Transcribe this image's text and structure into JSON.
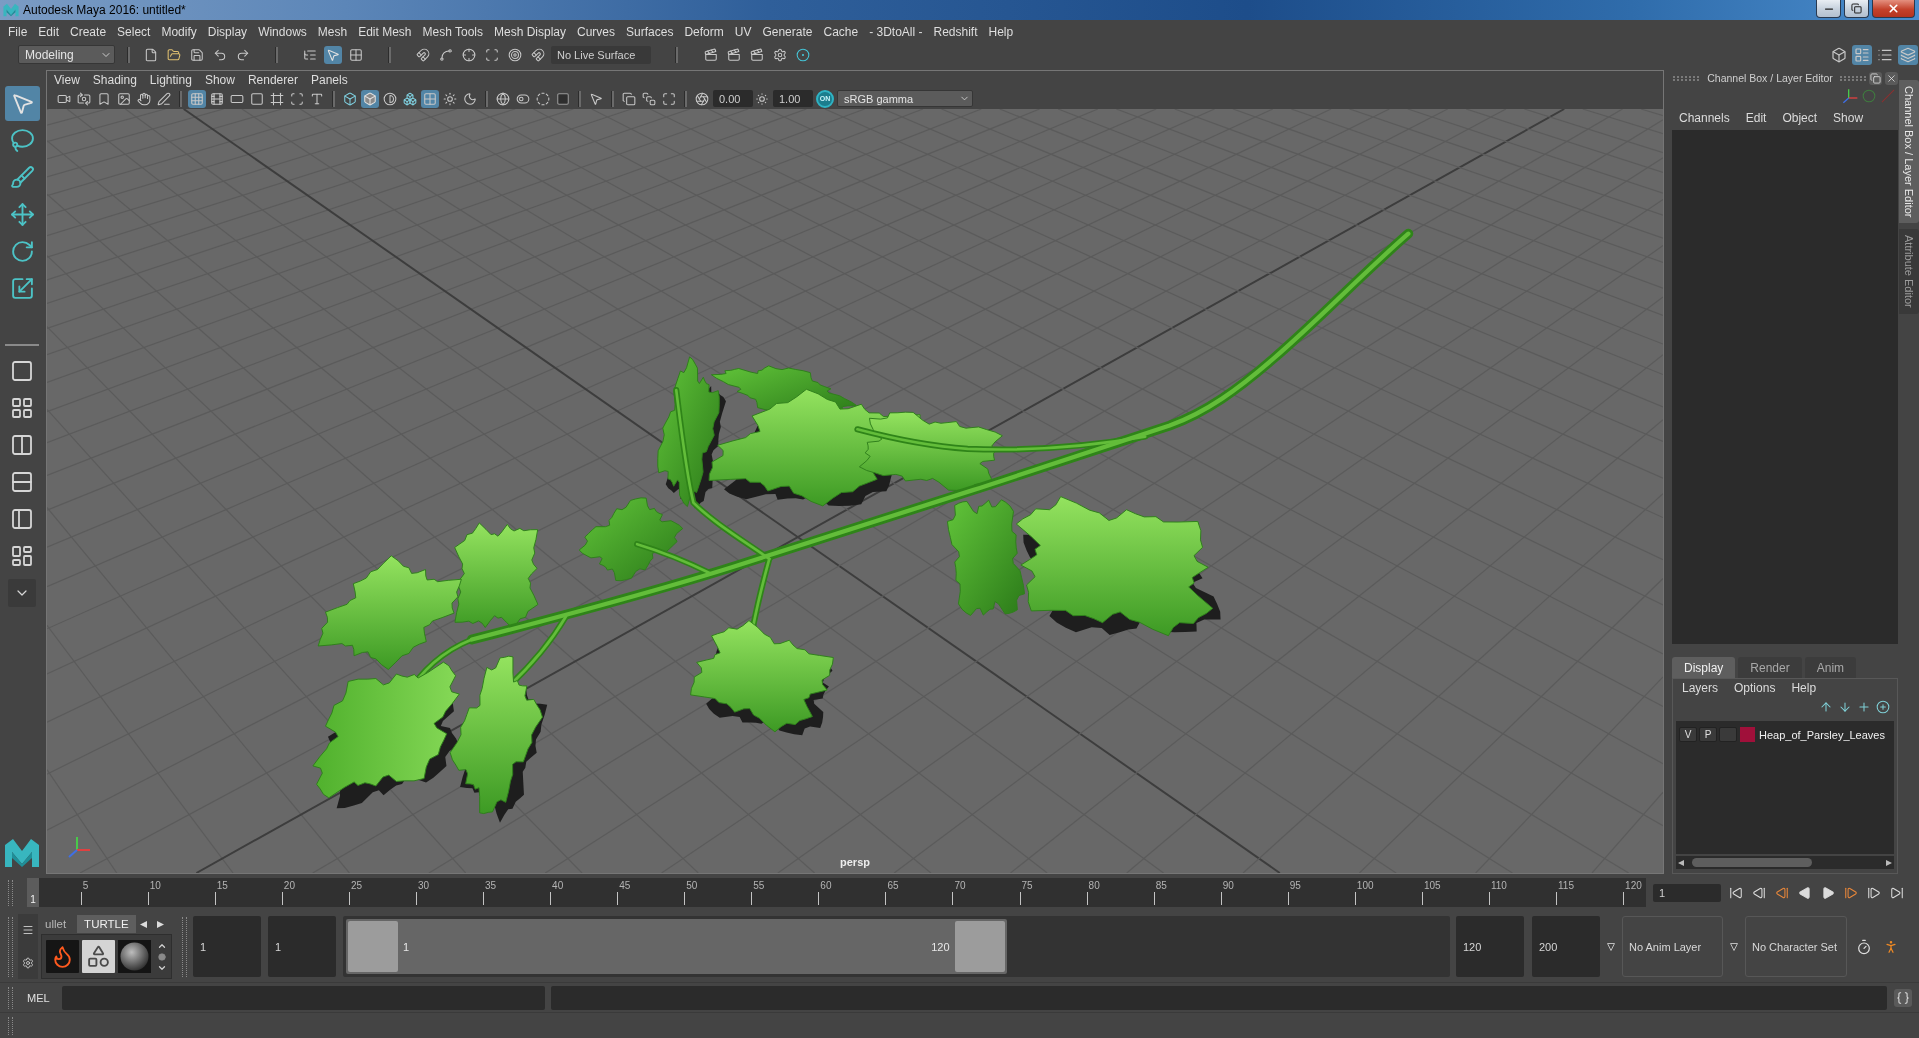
{
  "window": {
    "title": "Autodesk Maya 2016: untitled*"
  },
  "menu_bar": [
    "File",
    "Edit",
    "Create",
    "Select",
    "Modify",
    "Display",
    "Windows",
    "Mesh",
    "Edit Mesh",
    "Mesh Tools",
    "Mesh Display",
    "Curves",
    "Surfaces",
    "Deform",
    "UV",
    "Generate",
    "Cache",
    "- 3DtoAll -",
    "Redshift",
    "Help"
  ],
  "status_line": {
    "menu_set": "Modeling",
    "selection_modes": [
      {
        "kind": "hierarchy",
        "selected": false
      },
      {
        "kind": "object",
        "selected": true
      },
      {
        "kind": "component",
        "selected": false
      }
    ],
    "snap_tools": [
      {
        "kind": "grid",
        "selected": false
      },
      {
        "kind": "curve",
        "selected": false
      },
      {
        "kind": "point",
        "selected": false
      },
      {
        "kind": "plane",
        "selected": false
      },
      {
        "kind": "center",
        "selected": false
      },
      {
        "kind": "live",
        "selected": false
      }
    ],
    "live_surface": "No Live Surface",
    "panel_toggles": [
      {
        "kind": "toolkit",
        "selected": false
      },
      {
        "kind": "attributes",
        "selected": true
      },
      {
        "kind": "settings",
        "selected": false
      },
      {
        "kind": "channels",
        "selected": true
      }
    ]
  },
  "toolbox": {
    "tools": [
      {
        "kind": "select",
        "selected": true
      },
      {
        "kind": "lasso",
        "selected": false
      },
      {
        "kind": "paint",
        "selected": false
      },
      {
        "kind": "move",
        "selected": false
      },
      {
        "kind": "rotate",
        "selected": false
      },
      {
        "kind": "scale",
        "selected": false
      }
    ]
  },
  "viewport": {
    "menu": [
      "View",
      "Shading",
      "Lighting",
      "Show",
      "Renderer",
      "Panels"
    ],
    "toolbar": [
      [
        {
          "kind": "camera",
          "selected": false
        },
        {
          "kind": "attributes",
          "selected": false
        },
        {
          "kind": "bookmark",
          "selected": false
        },
        {
          "kind": "imageplane",
          "selected": false
        },
        {
          "kind": "pan",
          "selected": false
        },
        {
          "kind": "pencil",
          "selected": false
        }
      ],
      [
        {
          "kind": "grid",
          "selected": true
        },
        {
          "kind": "filmgate",
          "selected": false
        },
        {
          "kind": "resgate",
          "selected": false
        },
        {
          "kind": "gatemask",
          "selected": false
        },
        {
          "kind": "fieldchart",
          "selected": false
        },
        {
          "kind": "safeaction",
          "selected": false
        },
        {
          "kind": "safetitle",
          "selected": false
        }
      ],
      [
        {
          "kind": "wireframe",
          "selected": false
        },
        {
          "kind": "shaded",
          "selected": true
        },
        {
          "kind": "material",
          "selected": false
        },
        {
          "kind": "wireonshaded",
          "selected": false
        },
        {
          "kind": "xray",
          "selected": true
        },
        {
          "kind": "lights",
          "selected": false
        },
        {
          "kind": "shadows",
          "selected": false
        }
      ],
      [
        {
          "kind": "textures",
          "selected": false
        },
        {
          "kind": "toggles",
          "selected": false
        },
        {
          "kind": "occlusion",
          "selected": false
        },
        {
          "kind": "antialias",
          "selected": false
        }
      ],
      [
        {
          "kind": "isolate",
          "selected": false
        }
      ],
      [
        {
          "kind": "xrayjoints",
          "selected": false
        },
        {
          "kind": "xraycomponents",
          "selected": false
        },
        {
          "kind": "backface",
          "selected": false
        }
      ]
    ],
    "exposure": "0.00",
    "gamma": "1.00",
    "color_management": {
      "label": "ON",
      "selected": true
    },
    "view_transform": "sRGB gamma",
    "camera": "persp"
  },
  "channel_box": {
    "title": "Channel Box / Layer Editor",
    "menu": [
      "Channels",
      "Edit",
      "Object",
      "Show"
    ]
  },
  "layer_editor": {
    "tabs": [
      {
        "label": "Display",
        "selected": true
      },
      {
        "label": "Render",
        "selected": false
      },
      {
        "label": "Anim",
        "selected": false
      }
    ],
    "menu": [
      "Layers",
      "Options",
      "Help"
    ],
    "layers": [
      {
        "visibility": "V",
        "playback": "P",
        "color": "#a0103a",
        "name": "Heap_of_Parsley_Leaves"
      }
    ]
  },
  "side_tabs": [
    {
      "label": "Channel Box / Layer Editor",
      "selected": true
    },
    {
      "label": "Attribute Editor",
      "selected": false
    }
  ],
  "time_slider": {
    "current": "1",
    "level": 0,
    "ticks": [
      "5",
      "10",
      "15",
      "20",
      "25",
      "30",
      "35",
      "40",
      "45",
      "50",
      "55",
      "60",
      "65",
      "70",
      "75",
      "80",
      "85",
      "90",
      "95",
      "100",
      "105",
      "110",
      "115",
      "120"
    ],
    "current_frame": "1"
  },
  "range_slider": {
    "shelf_tabs": [
      {
        "label": "ullet",
        "selected": false
      },
      {
        "label": "TURTLE",
        "selected": true
      }
    ],
    "animation_start": "1",
    "playback_start": "1",
    "range_start": "1",
    "range_end": "120",
    "level": 0.6,
    "playback_end": "120",
    "animation_end": "200",
    "anim_layer": "No Anim Layer",
    "character_set": "No Character Set"
  },
  "command_line": {
    "language": "MEL"
  }
}
